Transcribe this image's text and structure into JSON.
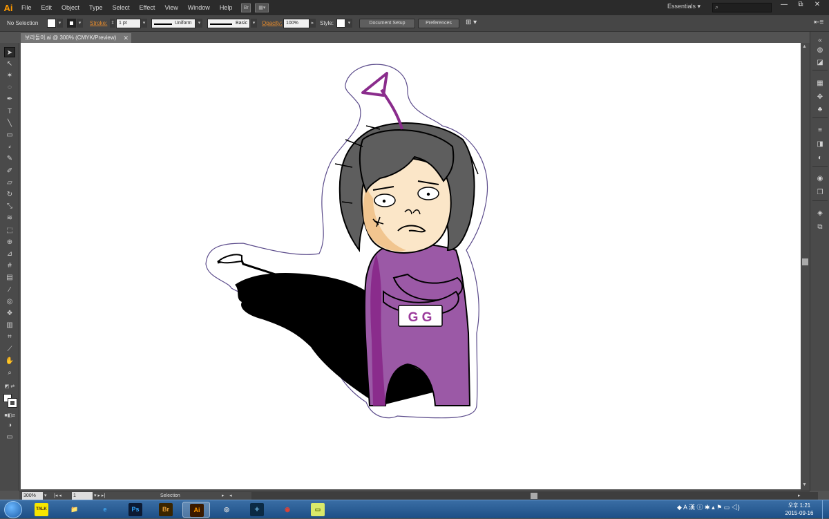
{
  "app": {
    "logo": "Ai",
    "menu": [
      "File",
      "Edit",
      "Object",
      "Type",
      "Select",
      "Effect",
      "View",
      "Window",
      "Help"
    ],
    "bridge_badge": "Br",
    "workspace": "Essentials",
    "window_controls": [
      "—",
      "⧉",
      "✕"
    ]
  },
  "controlbar": {
    "selection_label": "No Selection",
    "stroke_label": "Stroke:",
    "stroke_weight": "1 pt",
    "profile": "Uniform",
    "brush": "Basic",
    "opacity_label": "Opacity:",
    "opacity_value": "100%",
    "style_label": "Style:",
    "document_setup": "Document Setup",
    "preferences": "Preferences"
  },
  "document": {
    "tab_title": "보라돌이.ai @ 300% (CMYK/Preview)",
    "close": "✕"
  },
  "statusbar": {
    "zoom": "300%",
    "artboard": "1",
    "tool_status": "Selection"
  },
  "taskbar": {
    "apps": [
      {
        "name": "KakaoTalk",
        "label": "TALK",
        "color": "#f7e600",
        "fg": "#3c1e1e"
      },
      {
        "name": "Explorer",
        "label": "📁",
        "color": "transparent",
        "fg": "#f4c542"
      },
      {
        "name": "Internet Explorer",
        "label": "e",
        "color": "transparent",
        "fg": "#3fa9f5"
      },
      {
        "name": "Photoshop",
        "label": "Ps",
        "color": "#0c1a33",
        "fg": "#31a8ff"
      },
      {
        "name": "Bridge",
        "label": "Br",
        "color": "#3a2500",
        "fg": "#e8a23a"
      },
      {
        "name": "Illustrator",
        "label": "Ai",
        "color": "#3a1a00",
        "fg": "#ff9a00"
      },
      {
        "name": "Media",
        "label": "◎",
        "color": "transparent",
        "fg": "#e0e0e0"
      },
      {
        "name": "Dreamweaver",
        "label": "✧",
        "color": "#0b2a44",
        "fg": "#7fd0ff"
      },
      {
        "name": "Chrome",
        "label": "◉",
        "color": "transparent",
        "fg": "#e34133"
      },
      {
        "name": "Sticky Notes",
        "label": "▭",
        "color": "#d9e96a",
        "fg": "#556b00"
      }
    ],
    "tray_ime": "A 漢",
    "time": "오후 1:21",
    "date": "2015-09-16"
  },
  "artwork": {
    "badge_text": "G G",
    "colors": {
      "suit": "#9b59a6",
      "suit_dark": "#8a2c8c",
      "hair": "#5e5e5e",
      "skin": "#fbe6c8",
      "outline": "#5a4a8a"
    }
  }
}
